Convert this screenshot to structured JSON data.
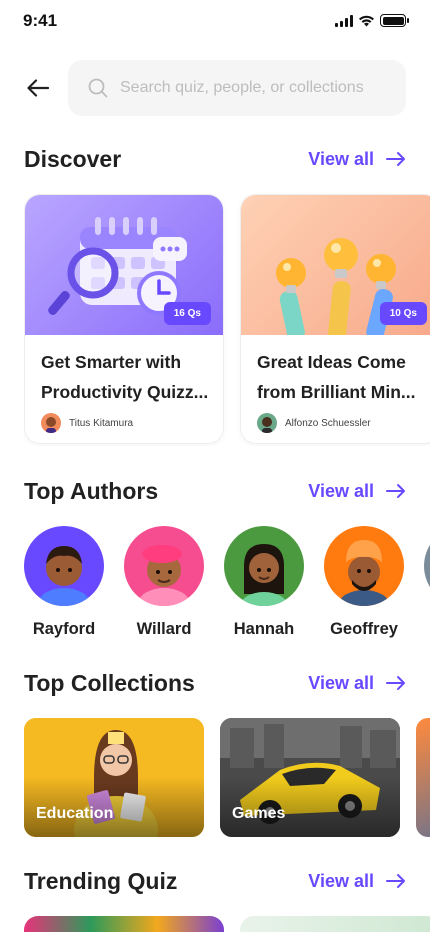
{
  "status_bar": {
    "time": "9:41"
  },
  "search": {
    "placeholder": "Search quiz, people, or collections"
  },
  "sections": {
    "discover": {
      "title": "Discover",
      "view_all": "View all"
    },
    "top_authors": {
      "title": "Top Authors",
      "view_all": "View all"
    },
    "top_collections": {
      "title": "Top Collections",
      "view_all": "View all"
    },
    "trending": {
      "title": "Trending Quiz",
      "view_all": "View all"
    }
  },
  "discover_cards": [
    {
      "title": "Get Smarter with Productivity Quizz...",
      "badge": "16 Qs",
      "author": "Titus Kitamura",
      "image": "calendar-magnifier-illustration"
    },
    {
      "title": "Great Ideas Come from Brilliant Min...",
      "badge": "10 Qs",
      "author": "Alfonzo Schuessler",
      "image": "hands-holding-lightbulbs-illustration"
    }
  ],
  "authors": [
    {
      "name": "Rayford",
      "bg": "#6949ff"
    },
    {
      "name": "Willard",
      "bg": "#f54d8f"
    },
    {
      "name": "Hannah",
      "bg": "#4c9a3f"
    },
    {
      "name": "Geoffrey",
      "bg": "#ff7a0f"
    }
  ],
  "collections": [
    {
      "label": "Education",
      "image": "student-with-books-photo"
    },
    {
      "label": "Games",
      "image": "yellow-sports-car-photo"
    }
  ],
  "colors": {
    "accent": "#6949ff",
    "text": "#212121",
    "muted": "#bdbdbd"
  }
}
